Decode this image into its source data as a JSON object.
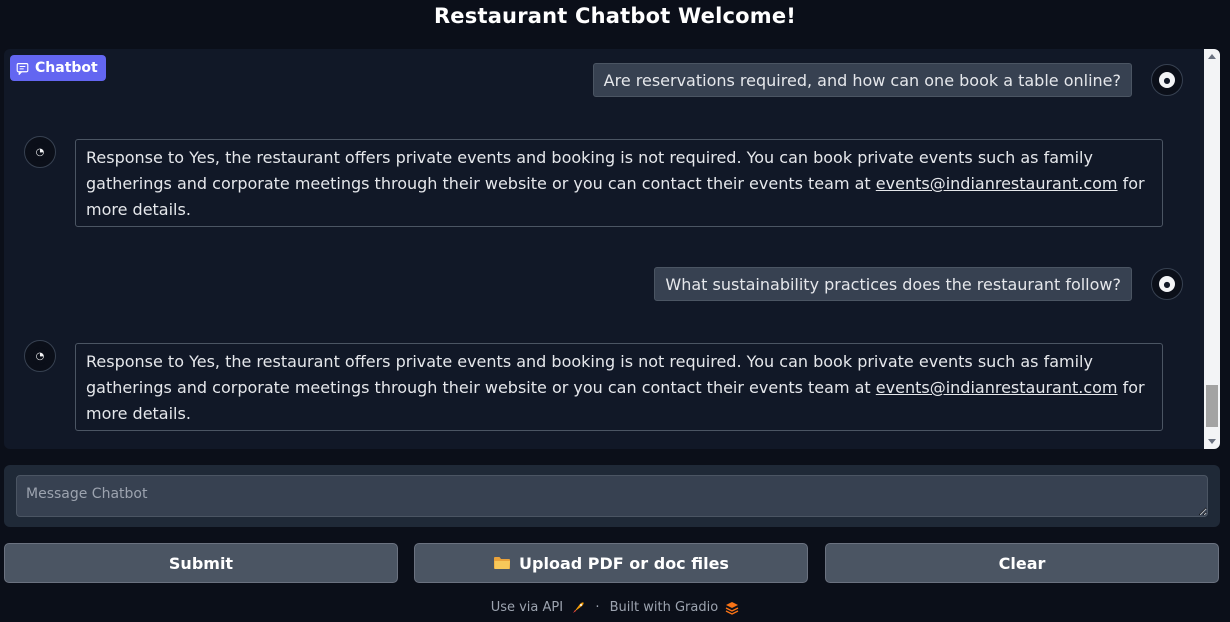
{
  "page": {
    "title": "Restaurant Chatbot Welcome!"
  },
  "chatbot": {
    "label": "Chatbot",
    "messages": [
      {
        "role": "user",
        "text": "Are reservations required, and how can one book a table online?"
      },
      {
        "role": "bot",
        "text_before": "Response to Yes, the restaurant offers private events and booking is not required. You can book private events such as family gatherings and corporate meetings through their website or you can contact their events team at ",
        "link": "events@indianrestaurant.com",
        "text_after": " for more details."
      },
      {
        "role": "user",
        "text": "What sustainability practices does the restaurant follow?"
      },
      {
        "role": "bot",
        "text_before": "Response to Yes, the restaurant offers private events and booking is not required. You can book private events such as family gatherings and corporate meetings through their website or you can contact their events team at ",
        "link": "events@indianrestaurant.com",
        "text_after": " for more details."
      }
    ]
  },
  "input": {
    "placeholder": "Message Chatbot"
  },
  "buttons": {
    "submit": "Submit",
    "upload": "Upload PDF or doc files",
    "upload_icon": "folder-icon",
    "clear": "Clear"
  },
  "footer": {
    "api": "Use via API",
    "separator": "·",
    "built": "Built with Gradio"
  },
  "colors": {
    "accent": "#6366f1",
    "background": "#0b0f19",
    "panel": "#111827"
  }
}
